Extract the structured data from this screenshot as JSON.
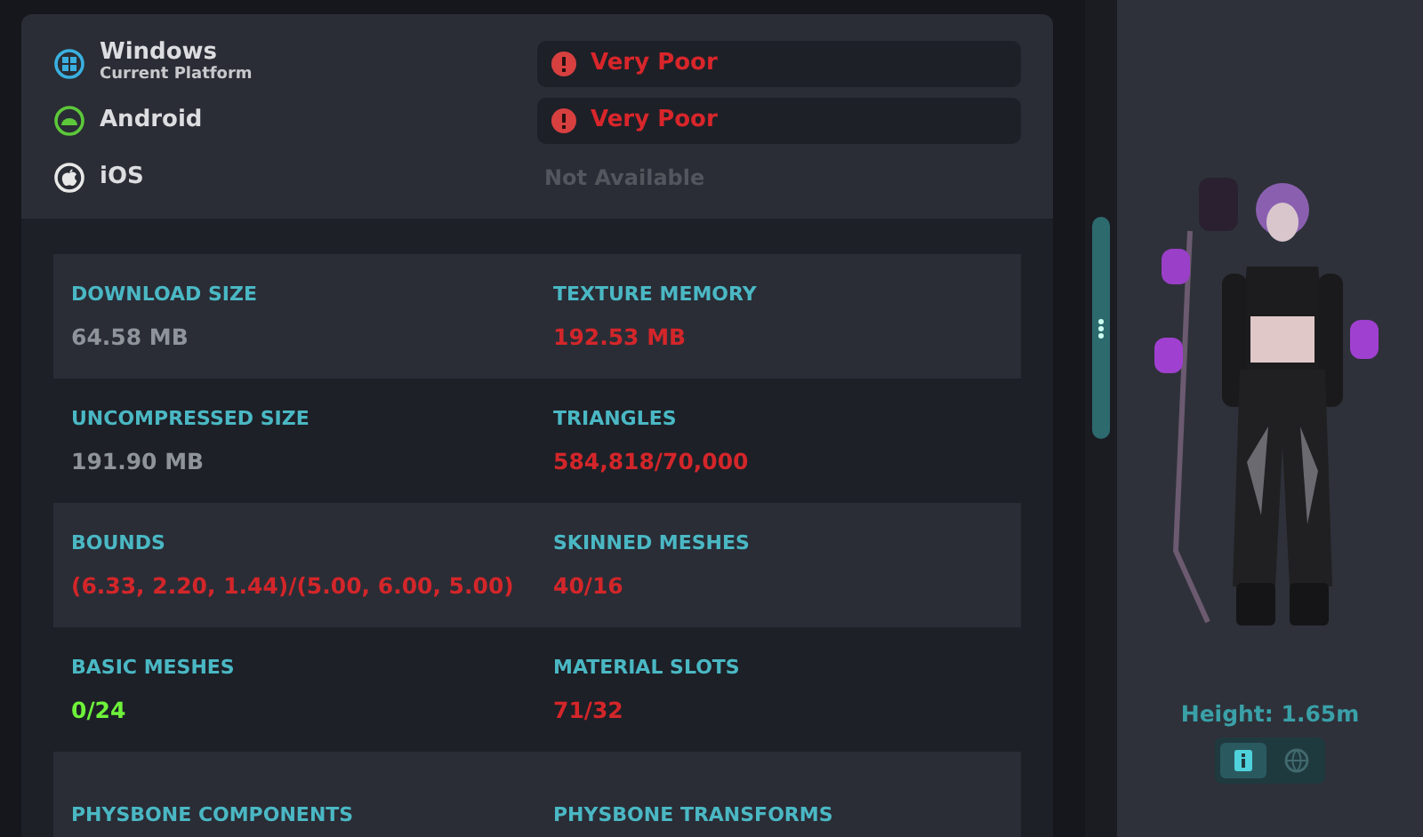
{
  "platforms": [
    {
      "name": "Windows",
      "subtitle": "Current Platform",
      "kind": "windows",
      "rating": {
        "kind": "poor",
        "text": "Very Poor"
      }
    },
    {
      "name": "Android",
      "kind": "android",
      "rating": {
        "kind": "poor",
        "text": "Very Poor"
      }
    },
    {
      "name": "iOS",
      "kind": "ios",
      "rating": {
        "kind": "unavailable",
        "text": "Not Available"
      }
    }
  ],
  "stats": [
    {
      "label": "DOWNLOAD SIZE",
      "value": "64.58 MB",
      "kind": "neutral"
    },
    {
      "label": "TEXTURE MEMORY",
      "value": "192.53 MB",
      "kind": "bad"
    },
    {
      "label": "UNCOMPRESSED SIZE",
      "value": "191.90 MB",
      "kind": "neutral"
    },
    {
      "label": "TRIANGLES",
      "value": "584,818/70,000",
      "kind": "bad"
    },
    {
      "label": "BOUNDS",
      "value": "(6.33, 2.20, 1.44)/(5.00, 6.00, 5.00)",
      "kind": "bad"
    },
    {
      "label": "SKINNED MESHES",
      "value": "40/16",
      "kind": "bad"
    },
    {
      "label": "BASIC MESHES",
      "value": "0/24",
      "kind": "good"
    },
    {
      "label": "MATERIAL SLOTS",
      "value": "71/32",
      "kind": "bad"
    },
    {
      "label": "PHYSBONE COMPONENTS"
    },
    {
      "label": "PHYSBONE TRANSFORMS"
    }
  ],
  "preview": {
    "height": "Height: 1.65m",
    "view_toggle": [
      {
        "kind": "info",
        "selected": true
      },
      {
        "kind": "globe",
        "selected": false
      }
    ]
  }
}
